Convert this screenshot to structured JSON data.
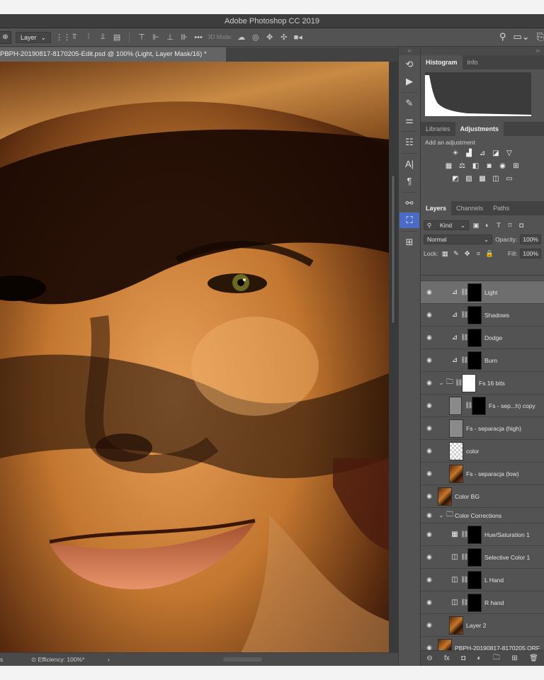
{
  "window": {
    "title": "Adobe Photoshop CC 2019"
  },
  "options_bar": {
    "tool_glyph": "⊕",
    "auto_select_label": "Layer",
    "more_label": "•••",
    "mode_label": "3D Mode:",
    "icons": [
      "align-top",
      "align-vcenter",
      "align-bottom",
      "align-left",
      "align-hcenter",
      "align-right"
    ],
    "right_icons": [
      "search-icon",
      "workspace-icon",
      "share-icon"
    ]
  },
  "document": {
    "tab_title": "PBPH-20190817-8170205-Edit.psd @ 100% (Light, Layer Mask/16) *",
    "status_left": "s",
    "status_efficiency": "Efficiency: 100%*",
    "status_arrow": "›"
  },
  "panels": {
    "histogram": {
      "tabs": [
        "Histogram",
        "Info"
      ]
    },
    "adjustments": {
      "tabs": [
        "Libraries",
        "Adjustments"
      ],
      "hint": "Add an adjustment"
    },
    "layers": {
      "tabs": [
        "Layers",
        "Channels",
        "Paths"
      ],
      "filter_label": "Kind",
      "blend_mode": "Normal",
      "opacity_label": "Opacity:",
      "opacity_value": "100%",
      "lock_label": "Lock:",
      "fill_label": "Fill:",
      "fill_value": "100%",
      "items": [
        {
          "name": "Light",
          "thumb": "mask",
          "adj": "curves",
          "selected": true
        },
        {
          "name": "Shadows",
          "thumb": "mask",
          "adj": "curves"
        },
        {
          "name": "Dodge",
          "thumb": "mask",
          "adj": "curves"
        },
        {
          "name": "Burn",
          "thumb": "mask",
          "adj": "curves"
        },
        {
          "name": "Fs 16 bits",
          "group": true
        },
        {
          "name": "Fs - sep...h) copy",
          "thumb": "grey+mask"
        },
        {
          "name": "Fs - separacja (high)",
          "thumb": "grey"
        },
        {
          "name": "color",
          "thumb": "checker"
        },
        {
          "name": "Fs - separacja (low)",
          "thumb": "photo"
        },
        {
          "name": "Color BG",
          "thumb": "photo"
        },
        {
          "name": "Color Corrections",
          "group": true
        },
        {
          "name": "Hue/Saturation 1",
          "adj": "hue"
        },
        {
          "name": "Selective Color 1",
          "adj": "selective"
        },
        {
          "name": "L Hand",
          "adj": "selective"
        },
        {
          "name": "R hand",
          "adj": "selective"
        },
        {
          "name": "Layer 2",
          "thumb": "photo"
        },
        {
          "name": "PBPH-20190817-8170205.ORF",
          "thumb": "photo"
        }
      ]
    }
  }
}
